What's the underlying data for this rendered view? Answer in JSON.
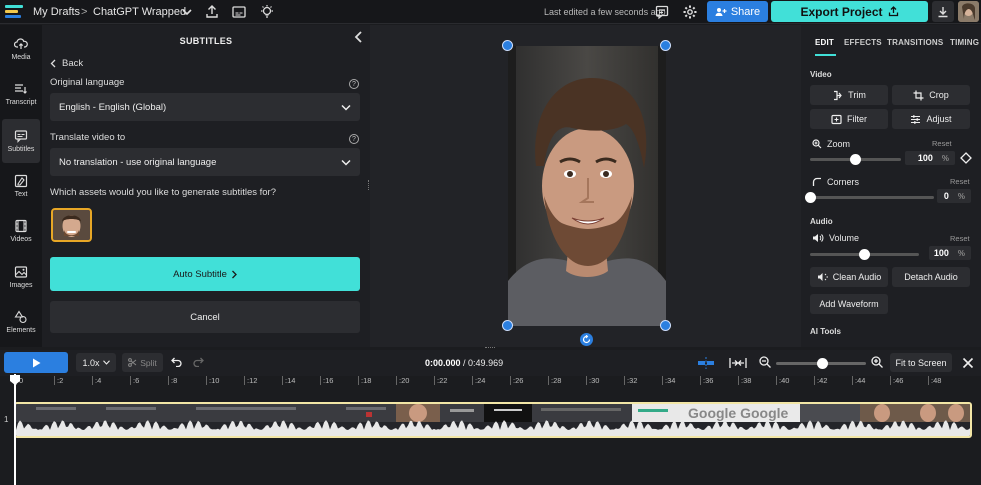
{
  "topbar": {
    "breadcrumb_root": "My Drafts",
    "breadcrumb_sep": ">",
    "project_name": "ChatGPT Wrapped",
    "last_edited": "Last edited a few seconds ago",
    "share_label": "Share",
    "export_label": "Export Project"
  },
  "rail": {
    "items": [
      {
        "label": "Media",
        "icon": "cloud-upload-icon"
      },
      {
        "label": "Transcript",
        "icon": "transcript-icon"
      },
      {
        "label": "Subtitles",
        "icon": "subtitles-icon",
        "active": true
      },
      {
        "label": "Text",
        "icon": "text-icon"
      },
      {
        "label": "Videos",
        "icon": "film-icon"
      },
      {
        "label": "Images",
        "icon": "image-icon"
      },
      {
        "label": "Elements",
        "icon": "shapes-icon"
      }
    ]
  },
  "panel": {
    "title": "SUBTITLES",
    "back_label": "Back",
    "original_language_label": "Original language",
    "original_language_value": "English - English (Global)",
    "translate_label": "Translate video to",
    "translate_value": "No translation - use original language",
    "assets_question": "Which assets would you like to generate subtitles for?",
    "auto_subtitle_label": "Auto Subtitle",
    "cancel_label": "Cancel"
  },
  "right_panel": {
    "tabs": [
      "EDIT",
      "EFFECTS",
      "TRANSITIONS",
      "TIMING"
    ],
    "active_tab": "EDIT",
    "video_section": "Video",
    "trim_label": "Trim",
    "crop_label": "Crop",
    "filter_label": "Filter",
    "adjust_label": "Adjust",
    "zoom_label": "Zoom",
    "zoom_value": "100",
    "zoom_unit": "%",
    "zoom_fraction": 0.5,
    "corners_label": "Corners",
    "corners_value": "0",
    "corners_unit": "%",
    "corners_fraction": 0.0,
    "reset_label": "Reset",
    "audio_section": "Audio",
    "volume_label": "Volume",
    "volume_value": "100",
    "volume_unit": "%",
    "volume_fraction": 0.5,
    "clean_audio_label": "Clean Audio",
    "detach_audio_label": "Detach Audio",
    "add_waveform_label": "Add Waveform",
    "ai_tools_section": "AI Tools"
  },
  "timeline": {
    "speed_label": "1.0x",
    "split_label": "Split",
    "current_time": "0:00.000",
    "total_time": "/ 0:49.969",
    "fit_label": "Fit to Screen",
    "zoom_fraction": 0.52,
    "track_number": "1",
    "ruler": [
      "0",
      ":2",
      ":4",
      ":6",
      ":8",
      ":10",
      ":12",
      ":14",
      ":16",
      ":18",
      ":20",
      ":22",
      ":24",
      ":26",
      ":28",
      ":30",
      ":32",
      ":34",
      ":36",
      ":38",
      ":40",
      ":42",
      ":44",
      ":46",
      ":48"
    ]
  },
  "colors": {
    "accent_teal": "#41e0d8",
    "accent_blue": "#2b7fe0",
    "clip_border": "#f2e6a6",
    "thumbnail_border": "#e8a726"
  }
}
